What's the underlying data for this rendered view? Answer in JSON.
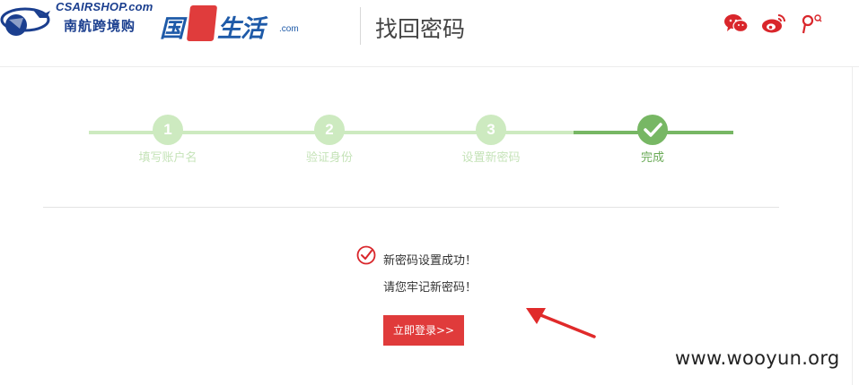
{
  "header": {
    "logo_site": "CSAIRSHOP.com",
    "logo_cn": "南航跨境购",
    "logo_gj_part1": "国",
    "logo_gj_part2": "生活",
    "logo_gj_com": ".com",
    "page_title": "找回密码",
    "social": [
      "wechat-icon",
      "weibo-icon",
      "tencent-weibo-icon"
    ]
  },
  "steps": [
    {
      "number": "1",
      "label": "填写账户名",
      "done": false
    },
    {
      "number": "2",
      "label": "验证身份",
      "done": false
    },
    {
      "number": "3",
      "label": "设置新密码",
      "done": false
    },
    {
      "number": "",
      "label": "完成",
      "done": true
    }
  ],
  "result": {
    "success": "新密码设置成功！",
    "remember": "请您牢记新密码！",
    "login_button": "立即登录>>"
  },
  "watermark": "www.wooyun.org",
  "colors": {
    "brand_blue": "#1e5aa8",
    "step_pending": "#cdeac0",
    "step_done": "#77b764",
    "button_red": "#e03b3b",
    "social_red": "#d9262b"
  }
}
